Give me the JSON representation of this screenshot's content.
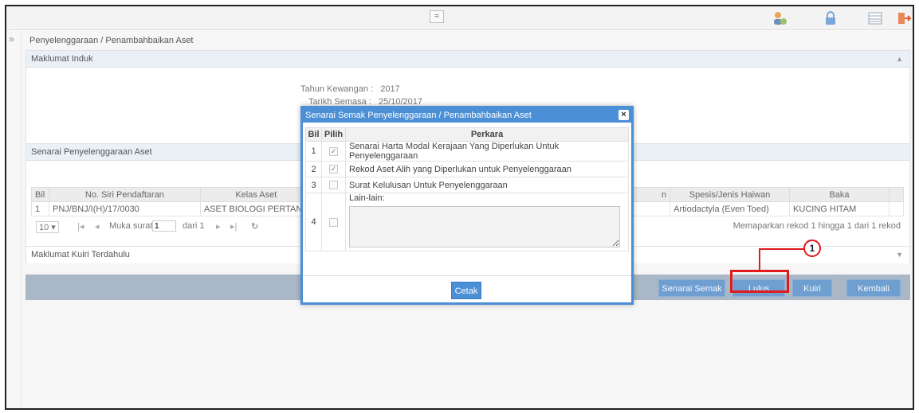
{
  "toolbar": {
    "collapse_glyph": "≈",
    "icons": [
      "user-icon",
      "lock-icon",
      "grid-icon",
      "logout-icon"
    ]
  },
  "breadcrumb": "Penyelenggaraan / Penambahbaikan Aset",
  "maklumat_induk": {
    "title": "Maklumat Induk",
    "tahun_label": "Tahun Kewangan :",
    "tahun_value": "2017",
    "tarikh_label": "Tarikh Semasa :",
    "tarikh_value": "25/10/2017"
  },
  "senarai_panel": {
    "title": "Senarai Penyelenggaraan Aset",
    "columns": [
      "Bil",
      "No. Siri Pendaftaran",
      "Kelas Aset",
      "n",
      "Spesis/Jenis Haiwan",
      "Baka"
    ],
    "row": {
      "bil": "1",
      "no_siri": "PNJ/BNJ/I(H)/17/0030",
      "kelas": "ASET BIOLOGI PERTANI",
      "spesis": "Artiodactyla (Even Toed)",
      "baka": "KUCING HITAM"
    },
    "pager": {
      "page_size": "10 ▾",
      "first": "|◂",
      "prev": "◂",
      "muka_surat": "Muka surat",
      "page_value": "1",
      "dari": "dari 1",
      "next": "▸",
      "last": "▸|",
      "refresh": "↻",
      "summary": "Memaparkan rekod 1 hingga 1 dari 1 rekod"
    }
  },
  "kuiri_panel": {
    "title": "Maklumat Kuiri Terdahulu"
  },
  "actions": {
    "senarai_semak": "Senarai Semak",
    "lulus": "Lulus",
    "kuiri": "Kuiri",
    "kembali": "Kembali"
  },
  "callout": {
    "number": "1"
  },
  "modal": {
    "title": "Senarai Semak Penyelenggaraan / Penambahbaikan Aset",
    "close": "×",
    "headers": {
      "bil": "Bil",
      "pilih": "Pilih",
      "perkara": "Perkara"
    },
    "items": [
      {
        "bil": "1",
        "checked": "✓",
        "perkara": "Senarai Harta Modal Kerajaan Yang Diperlukan Untuk Penyelenggaraan"
      },
      {
        "bil": "2",
        "checked": "✓",
        "perkara": "Rekod Aset Alih yang Diperlukan untuk Penyelenggaraan"
      },
      {
        "bil": "3",
        "checked": "",
        "perkara": "Surat Kelulusan Untuk Penyelenggaraan"
      },
      {
        "bil": "4",
        "checked": "",
        "perkara": "Lain-lain:"
      }
    ],
    "cetak": "Cetak"
  },
  "colors": {
    "accent": "#4b8fd6",
    "highlight": "#e01b1b",
    "action_bar": "#a9b7c6"
  }
}
